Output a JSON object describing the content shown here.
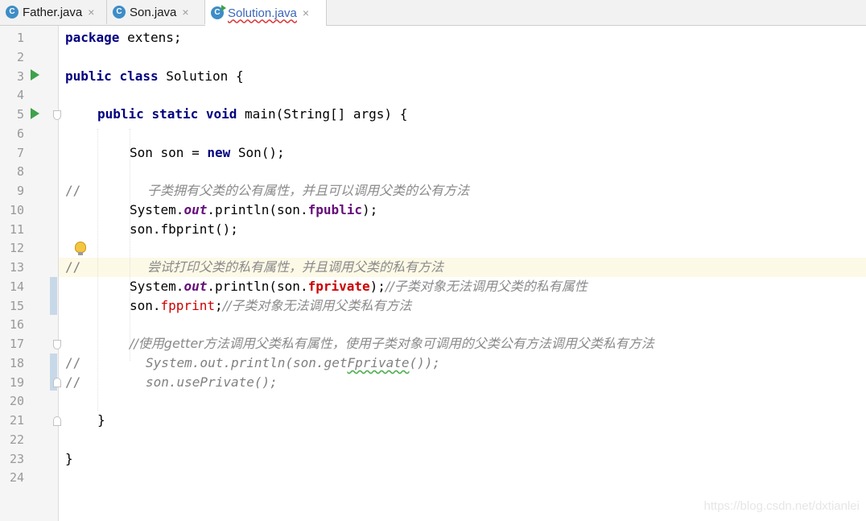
{
  "tabs": [
    {
      "label": "Father.java",
      "icon": "C",
      "close": "×",
      "active": false
    },
    {
      "label": "Son.java",
      "icon": "C",
      "close": "×",
      "active": false
    },
    {
      "label": "Solution.java",
      "icon": "C",
      "close": "×",
      "active": true
    }
  ],
  "line_numbers": [
    "1",
    "2",
    "3",
    "4",
    "5",
    "6",
    "7",
    "8",
    "9",
    "10",
    "11",
    "12",
    "13",
    "14",
    "15",
    "16",
    "17",
    "18",
    "19",
    "20",
    "21",
    "22",
    "23",
    "24"
  ],
  "code": {
    "l1": {
      "kw": "package",
      "rest": " extens;"
    },
    "l3": {
      "kw1": "public",
      "kw2": "class",
      "rest": " Solution {"
    },
    "l5": {
      "kw1": "public",
      "kw2": "static",
      "kw3": "void",
      "rest": " main(String[] args) {"
    },
    "l7": {
      "a": "Son son = ",
      "kw": "new",
      "b": " Son();"
    },
    "l9": {
      "prefix": "//",
      "comment": "子类拥有父类的公有属性，并且可以调用父类的公有方法"
    },
    "l10": {
      "a": "System.",
      "out": "out",
      "b": ".println(son.",
      "field": "fpublic",
      "c": ");"
    },
    "l11": {
      "a": "son.fbprint();"
    },
    "l13": {
      "prefix": "//",
      "comment": "尝试打印父类的私有属性，并且调用父类的私有方法"
    },
    "l14": {
      "a": "System.",
      "out": "out",
      "b": ".println(son.",
      "err": "fprivate",
      "c": ");",
      "comment": "//子类对象无法调用父类的私有属性"
    },
    "l15": {
      "a": "son.",
      "err": "fpprint",
      "c": ";",
      "comment": "//子类对象无法调用父类私有方法"
    },
    "l17": {
      "comment": "//使用getter方法调用父类私有属性，使用子类对象可调用的父类公有方法调用父类私有方法"
    },
    "l18": {
      "prefix": "//",
      "a": "System.out.println(son.get",
      "wavy": "Fprivate",
      "b": "());"
    },
    "l19": {
      "prefix": "//",
      "a": "son.usePrivate();"
    },
    "l21": {
      "a": "}"
    },
    "l23": {
      "a": "}"
    }
  },
  "watermark": "https://blog.csdn.net/dxtianlei"
}
